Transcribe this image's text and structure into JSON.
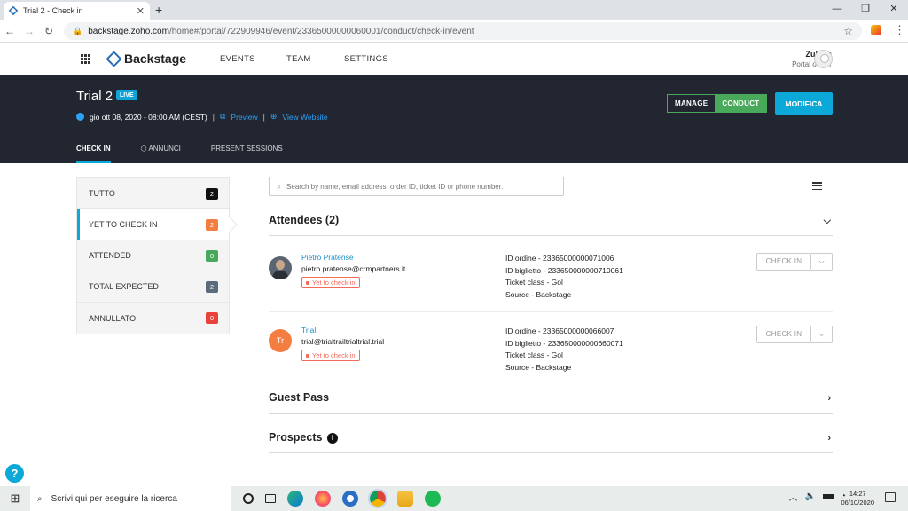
{
  "browser": {
    "tab_title": "Trial 2 - Check in",
    "close_glyph": "✕",
    "new_tab_glyph": "+",
    "url_host": "backstage.zoho.com",
    "url_path": "/home#/portal/722909946/event/23365000000060001/conduct/check-in/event",
    "window_controls": [
      "—",
      "❐",
      "✕"
    ]
  },
  "app": {
    "brand": "Backstage",
    "nav": [
      "EVENTS",
      "TEAM",
      "SETTINGS"
    ],
    "user_name": "Zuhma",
    "user_role": "Portal owner"
  },
  "event": {
    "title": "Trial 2",
    "live_badge": "LIVE",
    "datetime": "gio ott 08, 2020 - 08:00 AM (CEST)",
    "preview": "Preview",
    "view_website": "View Website",
    "separator": "|",
    "manage": "MANAGE",
    "conduct": "CONDUCT",
    "modifica": "MODIFICA",
    "tabs": [
      "CHECK IN",
      "ANNUNCI",
      "PRESENT SESSIONS"
    ]
  },
  "filters": [
    {
      "label": "TUTTO",
      "count": "2",
      "color": "#111111"
    },
    {
      "label": "YET TO CHECK IN",
      "count": "2",
      "color": "#f47d42"
    },
    {
      "label": "ATTENDED",
      "count": "0",
      "color": "#48a95a"
    },
    {
      "label": "TOTAL EXPECTED",
      "count": "2",
      "color": "#5b6b7b"
    },
    {
      "label": "ANNULLATO",
      "count": "0",
      "color": "#e8423a"
    }
  ],
  "search": {
    "placeholder": "Search by name, email address, order ID, ticket ID or phone number."
  },
  "sections": {
    "attendees": "Attendees (2)",
    "guest_pass": "Guest Pass",
    "prospects": "Prospects",
    "info_glyph": "i"
  },
  "attendees": [
    {
      "name": "Pietro Pratense",
      "email": "pietro.pratense@crmpartners.it",
      "status": "Yet to check in",
      "id_ordine": "ID ordine - 23365000000071006",
      "id_biglietto": "ID biglietto - 233650000000710061",
      "ticket_class": "Ticket class - Gol",
      "source": "Source - Backstage",
      "checkin_label": "CHECK IN"
    },
    {
      "name": "Trial",
      "initials": "Tr",
      "email": "trial@trialtrailtrialtrial.trial",
      "status": "Yet to check in",
      "id_ordine": "ID ordine - 23365000000066007",
      "id_biglietto": "ID biglietto - 233650000000660071",
      "ticket_class": "Ticket class - Gol",
      "source": "Source - Backstage",
      "checkin_label": "CHECK IN"
    }
  ],
  "help_glyph": "?",
  "taskbar": {
    "search_text": "Scrivi qui per eseguire la ricerca",
    "time": "14:27",
    "date": "06/10/2020"
  }
}
